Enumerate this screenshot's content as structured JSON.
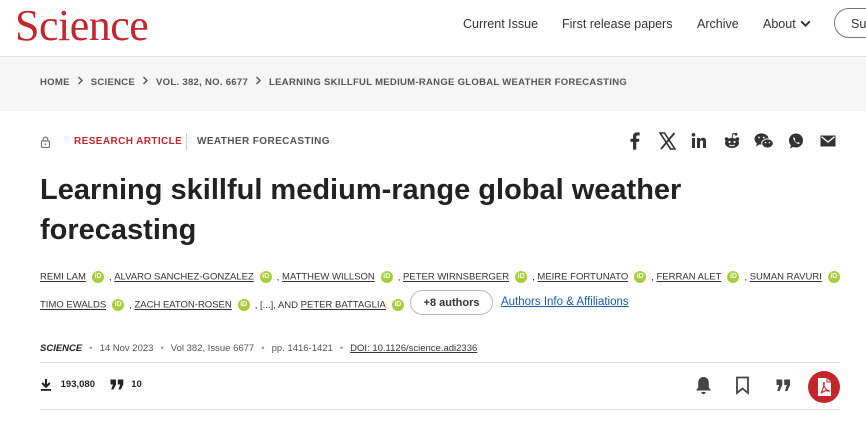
{
  "header": {
    "logo": "Science",
    "nav": [
      "Current Issue",
      "First release papers",
      "Archive",
      "About"
    ],
    "subscribe_label": "Su"
  },
  "breadcrumb": [
    "HOME",
    "SCIENCE",
    "VOL. 382, NO. 6677",
    "LEARNING SKILLFUL MEDIUM-RANGE GLOBAL WEATHER FORECASTING"
  ],
  "article": {
    "type": "RESEARCH ARTICLE",
    "category": "WEATHER FORECASTING",
    "title": "Learning skillful medium-range global weather forecasting",
    "authors_row1": [
      "REMI LAM",
      "ALVARO SANCHEZ-GONZALEZ",
      "MATTHEW WILLSON",
      "PETER WIRNSBERGER",
      "MEIRE FORTUNATO",
      "FERRAN ALET",
      "SUMAN RAVURI"
    ],
    "authors_row2": [
      "TIMO EWALDS",
      "ZACH EATON-ROSEN"
    ],
    "ellipsis": "[...], AND",
    "last_author": "PETER BATTAGLIA",
    "more_authors": "+8 authors",
    "affiliations_link": "Authors Info & Affiliations",
    "orcid": "iD"
  },
  "citation": {
    "journal": "SCIENCE",
    "date": "14 Nov 2023",
    "volume": "Vol 382, Issue 6677",
    "pages": "pp. 1416-1421",
    "doi": "DOI: 10.1126/science.adi2336"
  },
  "stats": {
    "downloads": "193,080",
    "citations": "10"
  },
  "share_icons": [
    "facebook-icon",
    "x-icon",
    "linkedin-icon",
    "reddit-icon",
    "wechat-icon",
    "whatsapp-icon",
    "email-icon"
  ],
  "colors": {
    "brand": "#c2272d",
    "orcid": "#a6ce39",
    "link": "#1a5aa8"
  }
}
